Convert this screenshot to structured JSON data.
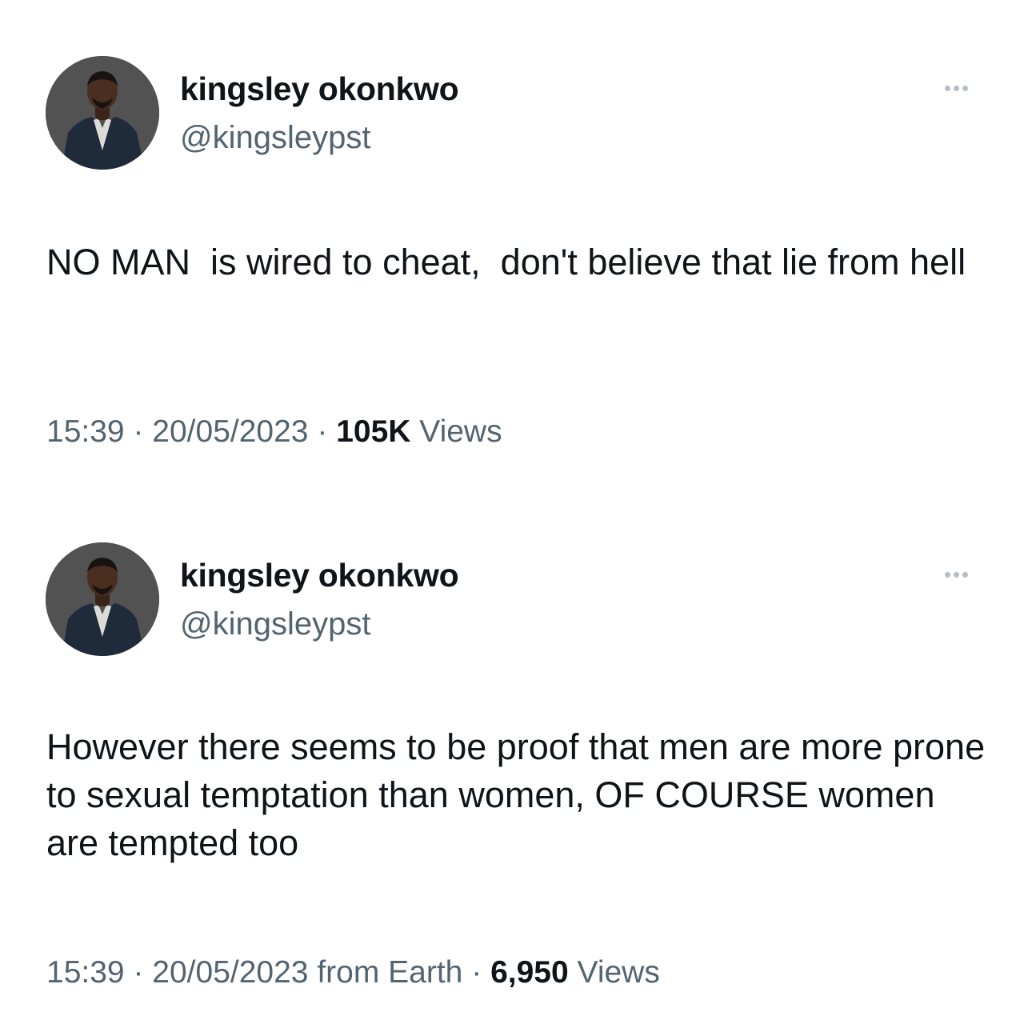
{
  "tweets": [
    {
      "author": {
        "display_name": "kingsley okonkwo",
        "handle": "@kingsleypst"
      },
      "more_icon": "more-horizontal-icon",
      "text": "NO MAN  is wired to cheat,  don't believe that lie from hell",
      "meta": {
        "time": "15:39",
        "separator": "·",
        "date": "20/05/2023",
        "views_count": "105K",
        "views_label": "Views"
      }
    },
    {
      "author": {
        "display_name": "kingsley okonkwo",
        "handle": "@kingsleypst"
      },
      "more_icon": "more-horizontal-icon",
      "text": "However there seems to be proof that men are more prone to sexual temptation than women, OF COURSE women are tempted too",
      "meta": {
        "time": "15:39",
        "separator": "·",
        "date": "20/05/2023 from Earth",
        "views_count": "6,950",
        "views_label": "Views"
      }
    }
  ],
  "colors": {
    "text_primary": "#0f1419",
    "text_secondary": "#536471",
    "background": "#ffffff"
  }
}
